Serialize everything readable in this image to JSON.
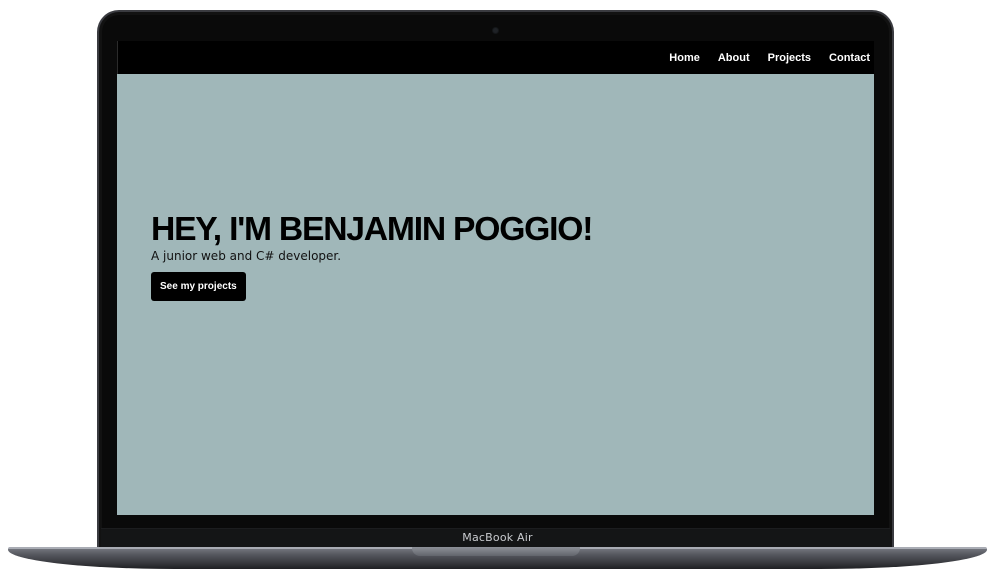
{
  "nav": {
    "items": [
      {
        "label": "Home"
      },
      {
        "label": "About"
      },
      {
        "label": "Projects"
      },
      {
        "label": "Contact"
      }
    ]
  },
  "hero": {
    "title": "HEY, I'M BENJAMIN POGGIO!",
    "subtitle": "A junior web and C# developer.",
    "cta_label": "See my projects"
  },
  "device": {
    "label": "MacBook Air"
  },
  "colors": {
    "page_background": "#a0b7b9",
    "navbar": "#000000",
    "button": "#000000",
    "text": "#000000"
  }
}
